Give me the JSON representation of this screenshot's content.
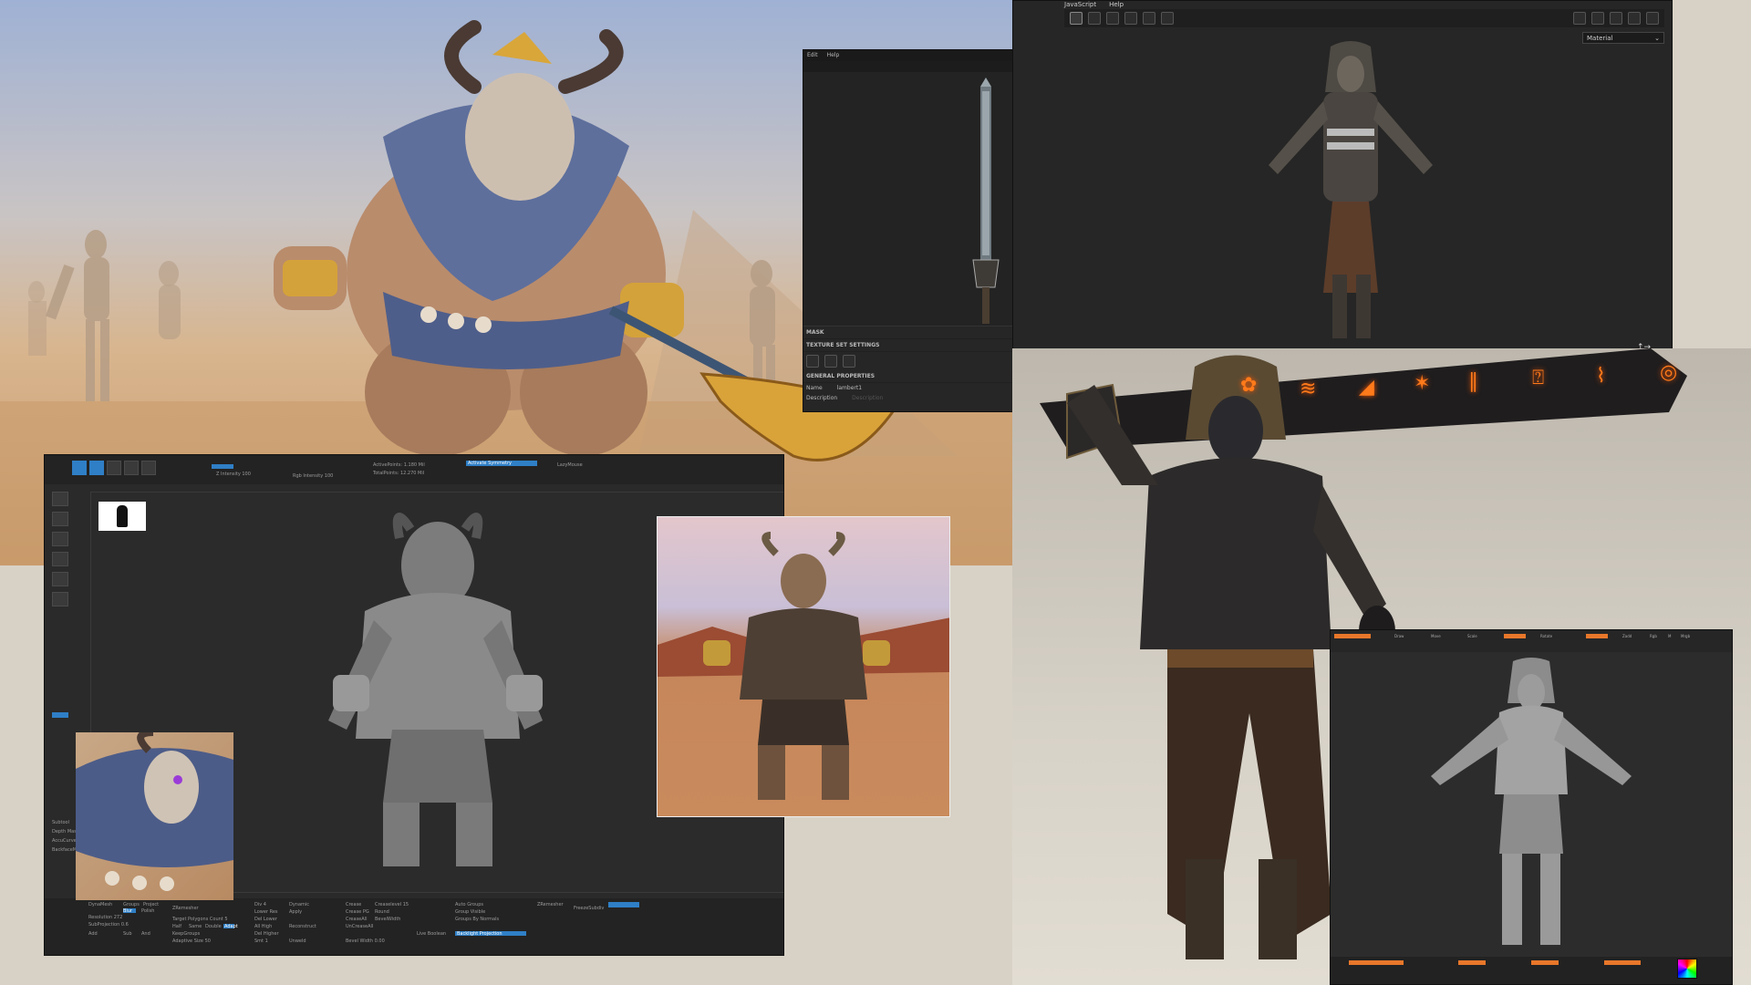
{
  "sword_editor": {
    "menu": [
      "Edit",
      "Help"
    ],
    "sections": {
      "mask": "MASK",
      "texture_set": "TEXTURE SET SETTINGS",
      "general": "GENERAL PROPERTIES"
    },
    "props": {
      "name_label": "Name",
      "name_value": "lambert1",
      "description_label": "Description",
      "description_placeholder": "Description"
    }
  },
  "viewer": {
    "menu": [
      "JavaScript",
      "Help"
    ],
    "material_select": "Material"
  },
  "zbrush": {
    "top_labels": {
      "active_points": "ActivePoints: 1.180 Mil",
      "total_points": "TotalPoints: 12.270 Mil",
      "symmetry": "Activate Symmetry",
      "z_intensity": "Z Intensity 100",
      "rgb_intensity": "Rgb Intensity 100",
      "loop_mode": "LazyMouse"
    },
    "bottom_labels": [
      "DynaMesh",
      "Groups",
      "Project",
      "Blur",
      "Polish",
      "Resolution 272",
      "SubProjection 0.6",
      "Add",
      "Sub",
      "And",
      "ZRemesher",
      "Target Polygons Count 5",
      "Half",
      "Same",
      "Double",
      "Adapt",
      "KeepGroups",
      "Adaptive Size 50",
      "Div 4",
      "Lower Res",
      "Del Lower",
      "All High",
      "Del Higher",
      "Smt 1",
      "Dynamic",
      "Apply",
      "Reconstruct",
      "Unweld",
      "Crease",
      "Crease PG",
      "CreaseAll",
      "UnCreaseAll",
      "Bevel Width 0.00",
      "Creaselevel 15",
      "Round",
      "BevelWidth",
      "Auto Groups",
      "Group Visible",
      "Groups By Normals",
      "Live Boolean",
      "Backlight Projection",
      "ZRemesher",
      "FreezeSubdiv"
    ],
    "side_labels": [
      "Subtool",
      "Depth Mask",
      "AccuCurve",
      "BackfaceMask"
    ]
  },
  "zbrush2": {
    "top_labels": [
      "Draw",
      "Move",
      "Scale",
      "Rotate",
      "Zadd",
      "Rgb",
      "M",
      "Mrgb"
    ]
  }
}
